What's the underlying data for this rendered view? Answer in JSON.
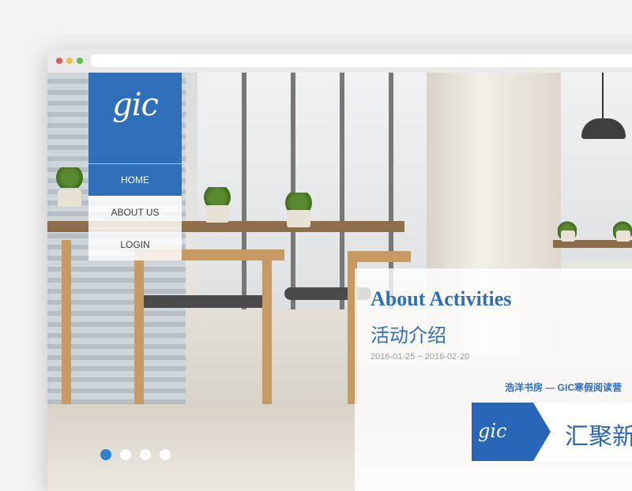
{
  "colors": {
    "brand_blue": "#2f6eb9",
    "dot_active": "#2f7fd2"
  },
  "logo": {
    "text": "gic"
  },
  "nav": [
    {
      "label": "HOME",
      "active": true
    },
    {
      "label": "ABOUT US",
      "active": false
    },
    {
      "label": "LOGIN",
      "active": false
    }
  ],
  "activity": {
    "title_en": "About Activities",
    "title_cn": "活动介绍",
    "date_range": "2016-01-25 ~ 2016-02-20",
    "tagline": "浩洋书房 — GIC寒假阅读营",
    "banner_logo": "gic",
    "banner_text": "汇聚新"
  },
  "slider": {
    "count": 4,
    "active_index": 1
  }
}
